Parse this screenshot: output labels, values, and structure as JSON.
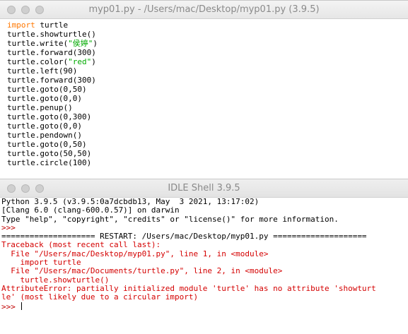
{
  "editor": {
    "title": "myp01.py - /Users/mac/Desktop/myp01.py (3.9.5)",
    "lines": [
      [
        {
          "t": "import",
          "c": "kw"
        },
        {
          "t": " turtle",
          "c": ""
        }
      ],
      [
        {
          "t": "turtle.showturtle()",
          "c": ""
        }
      ],
      [
        {
          "t": "turtle.write(",
          "c": ""
        },
        {
          "t": "\"侯婷\"",
          "c": "str"
        },
        {
          "t": ")",
          "c": ""
        }
      ],
      [
        {
          "t": "turtle.forward(300)",
          "c": ""
        }
      ],
      [
        {
          "t": "turtle.color(",
          "c": ""
        },
        {
          "t": "\"red\"",
          "c": "str"
        },
        {
          "t": ")",
          "c": ""
        }
      ],
      [
        {
          "t": "turtle.left(90)",
          "c": ""
        }
      ],
      [
        {
          "t": "turtle.forward(300)",
          "c": ""
        }
      ],
      [
        {
          "t": "turtle.goto(0,50)",
          "c": ""
        }
      ],
      [
        {
          "t": "turtle.goto(0,0)",
          "c": ""
        }
      ],
      [
        {
          "t": "turtle.penup()",
          "c": ""
        }
      ],
      [
        {
          "t": "turtle.goto(0,300)",
          "c": ""
        }
      ],
      [
        {
          "t": "turtle.goto(0,0)",
          "c": ""
        }
      ],
      [
        {
          "t": "turtle.pendown()",
          "c": ""
        }
      ],
      [
        {
          "t": "turtle.goto(0,50)",
          "c": ""
        }
      ],
      [
        {
          "t": "turtle.goto(50,50)",
          "c": ""
        }
      ],
      [
        {
          "t": "turtle.circle(100)",
          "c": ""
        }
      ]
    ]
  },
  "shell": {
    "title": "IDLE Shell 3.9.5",
    "lines": [
      {
        "t": "Python 3.9.5 (v3.9.5:0a7dcbdb13, May  3 2021, 13:17:02)",
        "c": ""
      },
      {
        "t": "[Clang 6.0 (clang-600.0.57)] on darwin",
        "c": ""
      },
      {
        "t": "Type \"help\", \"copyright\", \"credits\" or \"license()\" for more information.",
        "c": ""
      },
      {
        "t": ">>> ",
        "c": "prompt"
      },
      {
        "t": "==================== RESTART: /Users/mac/Desktop/myp01.py ====================",
        "c": "restart"
      },
      {
        "t": "Traceback (most recent call last):",
        "c": "err"
      },
      {
        "t": "  File \"/Users/mac/Desktop/myp01.py\", line 1, in <module>",
        "c": "err"
      },
      {
        "t": "    import turtle",
        "c": "err"
      },
      {
        "t": "  File \"/Users/mac/Documents/turtle.py\", line 2, in <module>",
        "c": "err"
      },
      {
        "t": "    turtle.showturtle()",
        "c": "err"
      },
      {
        "t": "AttributeError: partially initialized module 'turtle' has no attribute 'showturt",
        "c": "err"
      },
      {
        "t": "le' (most likely due to a circular import)",
        "c": "err"
      },
      {
        "t": ">>> ",
        "c": "prompt"
      }
    ]
  },
  "colors": {
    "keyword": "#ff7700",
    "string": "#00aa00",
    "error": "#d40000",
    "prompt": "#c00000"
  }
}
